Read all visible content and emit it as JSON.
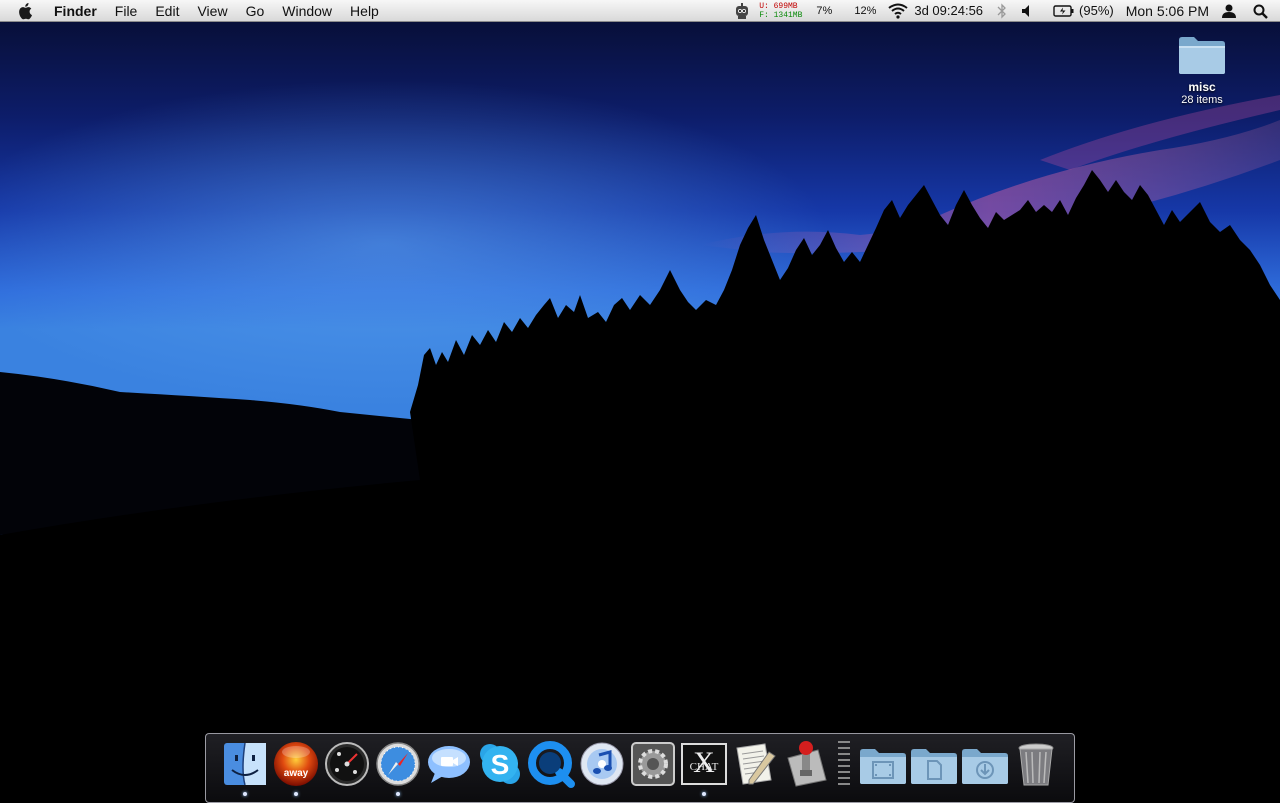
{
  "menubar": {
    "apple_icon": "apple-logo-icon",
    "app_name": "Finder",
    "menus": [
      "File",
      "Edit",
      "View",
      "Go",
      "Window",
      "Help"
    ],
    "status": {
      "memory_used": "U:   699MB",
      "memory_free": "F:  1341MB",
      "cpu1": "7%",
      "cpu2": "12%",
      "uptime": "3d 09:24:56",
      "battery": "(95%)",
      "clock": "Mon 5:06 PM"
    }
  },
  "desktop": {
    "folder_name": "misc",
    "folder_count": "28 items"
  },
  "dock": {
    "items": [
      {
        "name": "Finder",
        "icon": "finder-icon",
        "running": true
      },
      {
        "name": "Away",
        "label": "away",
        "icon": "away-icon",
        "running": true
      },
      {
        "name": "Dashboard",
        "icon": "dashboard-icon",
        "running": false
      },
      {
        "name": "Safari",
        "icon": "safari-icon",
        "running": true
      },
      {
        "name": "iChat",
        "icon": "ichat-icon",
        "running": false
      },
      {
        "name": "Skype",
        "icon": "skype-icon",
        "running": false
      },
      {
        "name": "QuickTime Player",
        "icon": "quicktime-icon",
        "running": false
      },
      {
        "name": "iTunes",
        "icon": "itunes-icon",
        "running": false
      },
      {
        "name": "System Preferences",
        "icon": "system-preferences-icon",
        "running": false
      },
      {
        "name": "X-Chat",
        "label": "CHAT",
        "icon": "xchat-icon",
        "running": true
      },
      {
        "name": "TextEdit",
        "icon": "textedit-icon",
        "running": false
      },
      {
        "name": "Transmission",
        "icon": "transmission-icon",
        "running": false
      },
      {
        "name": "Movies",
        "icon": "movies-folder-icon"
      },
      {
        "name": "Documents",
        "icon": "documents-folder-icon"
      },
      {
        "name": "Downloads",
        "icon": "downloads-folder-icon"
      },
      {
        "name": "Trash",
        "icon": "trash-icon"
      }
    ]
  }
}
